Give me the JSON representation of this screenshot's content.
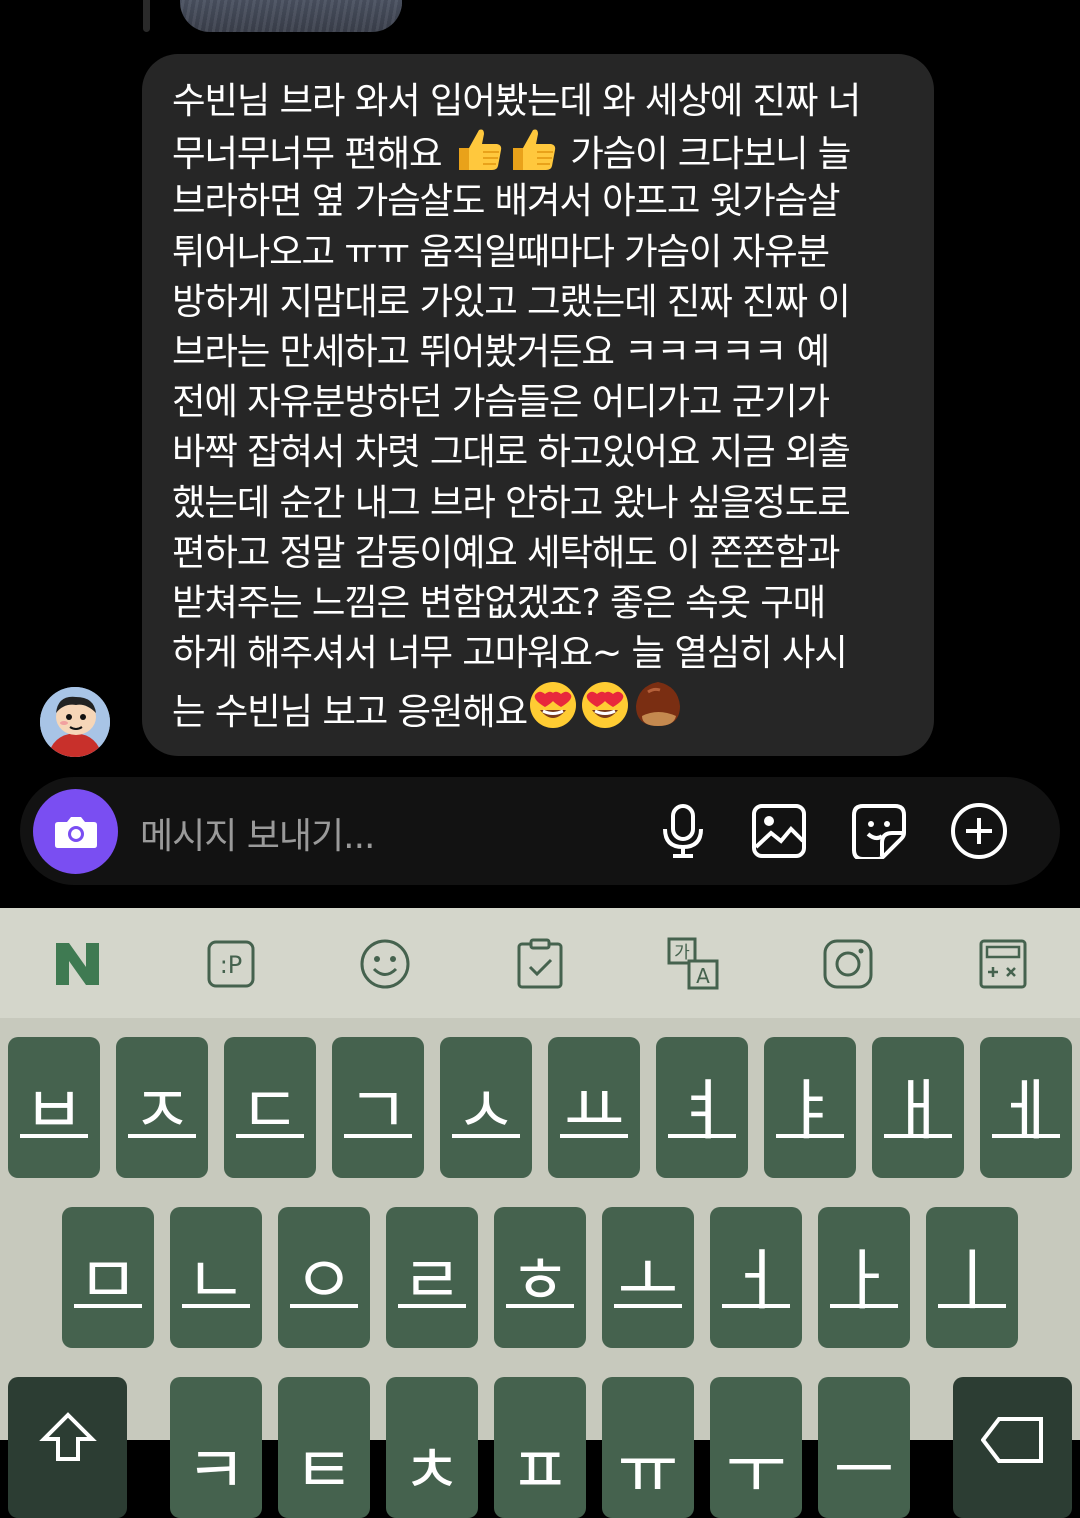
{
  "message": {
    "lines": [
      "수빈님 브라 와서 입어봤는데 와 세상에 진짜 너",
      "무너무너무 편해요",
      "가슴이 크다보니 늘",
      "브라하면 옆 가슴살도 배겨서 아프고 윗가슴살",
      "튀어나오고 ㅠㅠ 움직일때마다 가슴이 자유분",
      "방하게 지맘대로 가있고 그랬는데 진짜 진짜 이",
      "브라는 만세하고 뛰어봤거든요 ㅋㅋㅋㅋㅋ 예",
      "전에 자유분방하던 가슴들은 어디가고 군기가",
      "바짝 잡혀서 차렷 그대로 하고있어요 지금 외출",
      "했는데 순간 내그 브라 안하고 왔나 싶을정도로",
      "편하고 정말 감동이예요 세탁해도 이 쫀쫀함과",
      "받쳐주는 느낌은 변함없겠죠? 좋은 속옷 구매",
      "하게 해주셔서 너무 고마워요~ 늘 열심히 사시",
      "는 수빈님 보고 응원해요"
    ],
    "emojis_line2": [
      "thumbs-up",
      "thumbs-up"
    ],
    "emojis_end": [
      "heart-eyes",
      "heart-eyes",
      "chestnut"
    ]
  },
  "composer": {
    "placeholder": "메시지 보내기...",
    "accent": "#7a4ef2"
  },
  "keyboard": {
    "toolbar_icons": [
      "naver-n-icon",
      "p-icon",
      "emoji-icon",
      "clipboard-icon",
      "translate-icon",
      "instagram-icon",
      "calculator-icon"
    ],
    "row1": [
      "ㅂ",
      "ㅈ",
      "ㄷ",
      "ㄱ",
      "ㅅ",
      "ㅛ",
      "ㅕ",
      "ㅑ",
      "ㅐ",
      "ㅔ"
    ],
    "row2": [
      "ㅁ",
      "ㄴ",
      "ㅇ",
      "ㄹ",
      "ㅎ",
      "ㅗ",
      "ㅓ",
      "ㅏ",
      "ㅣ"
    ],
    "row3": [
      "ㅋ",
      "ㅌ",
      "ㅊ",
      "ㅍ",
      "ㅠ",
      "ㅜ",
      "ㅡ"
    ],
    "key_color": "#45624e",
    "bg_color": "#c7c9bd"
  }
}
